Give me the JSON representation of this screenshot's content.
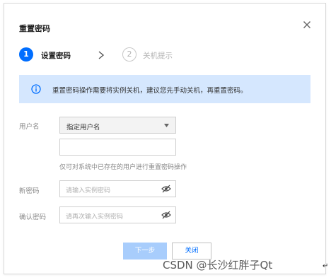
{
  "dialog": {
    "title": "重置密码",
    "close_icon": "close-icon"
  },
  "steps": [
    {
      "number": "1",
      "label": "设置密码",
      "state": "active"
    },
    {
      "number": "2",
      "label": "关机提示",
      "state": "inactive"
    }
  ],
  "notice": {
    "icon": "info-icon",
    "text": "重置密码操作需要将实例关机，建议您先手动关机，再重置密码。"
  },
  "form": {
    "username_label": "用户名",
    "username_select_value": "指定用户名",
    "username_input_value": "",
    "username_hint": "仅可对系统中已存在的用户进行重置密码操作",
    "new_password_label": "新密码",
    "new_password_placeholder": "请输入实例密码",
    "confirm_password_label": "确认密码",
    "confirm_password_placeholder": "请再次输入实例密码"
  },
  "buttons": {
    "next": "下一步",
    "close": "关闭"
  },
  "watermark": "CSDN @长沙红胖子Qt",
  "edge_arrow": "↵",
  "colors": {
    "primary": "#006eff",
    "notice_bg": "#d5e7fe",
    "disabled_button": "#a8cdfc"
  }
}
